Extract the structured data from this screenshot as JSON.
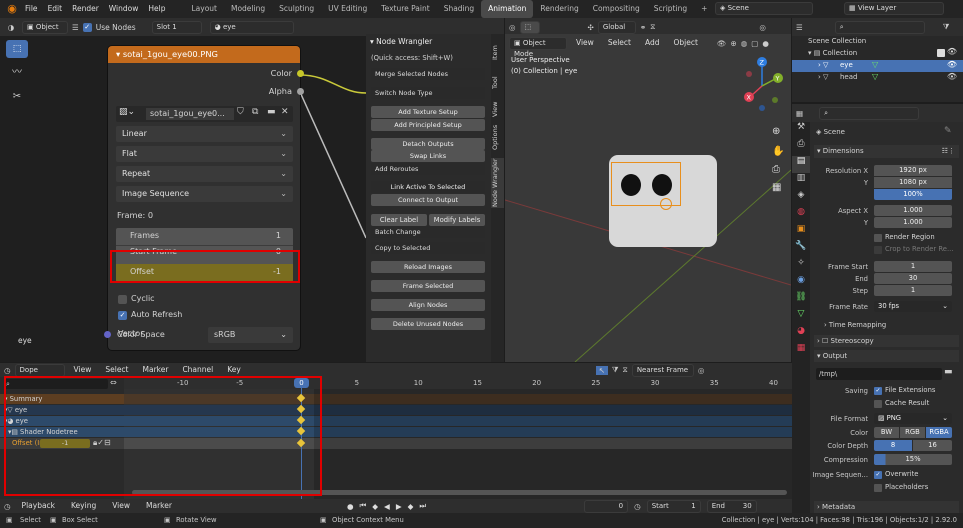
{
  "topbar": {
    "menus": [
      "File",
      "Edit",
      "Render",
      "Window",
      "Help"
    ],
    "workspaces": [
      "Layout",
      "Modeling",
      "Sculpting",
      "UV Editing",
      "Texture Paint",
      "Shading",
      "Animation",
      "Rendering",
      "Compositing",
      "Scripting"
    ],
    "active_workspace": "Animation",
    "add": "+",
    "scene": "Scene",
    "view_layer": "View Layer"
  },
  "node_editor": {
    "header": {
      "editor_type": "Object",
      "use_nodes": "Use Nodes",
      "slot": "Slot 1",
      "material": "eye"
    },
    "node": {
      "title": "sotai_1gou_eye00.PNG",
      "out_color": "Color",
      "out_alpha": "Alpha",
      "image_name": "sotai_1gou_eye0...",
      "interpolation": "Linear",
      "projection": "Flat",
      "extension": "Repeat",
      "source": "Image Sequence",
      "frame_label": "Frame: 0",
      "frames_label": "Frames",
      "frames_value": "1",
      "start_frame_label": "Start Frame",
      "start_frame_value": "0",
      "offset_label": "Offset",
      "offset_value": "-1",
      "cyclic": "Cyclic",
      "auto_refresh": "Auto Refresh",
      "color_space_label": "Color Space",
      "color_space_value": "sRGB",
      "in_vector": "Vector"
    },
    "material_label": "eye"
  },
  "node_wrangler": {
    "title": "Node Wrangler",
    "quick_access": "(Quick access: Shift+W)",
    "merge": "Merge Selected Nodes",
    "switch_type": "Switch Node Type",
    "add_texture": "Add Texture Setup",
    "add_principled": "Add Principled Setup",
    "detach": "Detach Outputs",
    "swap": "Swap Links",
    "add_reroutes": "Add Reroutes",
    "link_active": "Link Active To Selected",
    "connect_output": "Connect to Output",
    "clear_label": "Clear Label",
    "modify_labels": "Modify Labels",
    "batch_change": "Batch Change",
    "copy_selected": "Copy to Selected",
    "reload_images": "Reload Images",
    "frame_selected": "Frame Selected",
    "align_nodes": "Align Nodes",
    "delete_unused": "Delete Unused Nodes",
    "tabs": [
      "Item",
      "Tool",
      "View",
      "Options",
      "Node Wrangler"
    ]
  },
  "viewport": {
    "header": {
      "mode": "Object Mode",
      "menus": [
        "View",
        "Select",
        "Add",
        "Object"
      ],
      "orientation": "Global"
    },
    "perspective": "User Perspective",
    "collection": "(0) Collection | eye",
    "axes": {
      "x": "X",
      "y": "Y",
      "z": "Z"
    }
  },
  "outliner": {
    "scene_collection": "Scene Collection",
    "collection": "Collection",
    "items": [
      "eye",
      "head"
    ]
  },
  "properties": {
    "scene_name": "Scene",
    "dimensions": "Dimensions",
    "res_x_label": "Resolution X",
    "res_x": "1920 px",
    "res_y_label": "Y",
    "res_y": "1080 px",
    "res_pct": "100%",
    "aspect_x_label": "Aspect X",
    "aspect_x": "1.000",
    "aspect_y_label": "Y",
    "aspect_y": "1.000",
    "render_region": "Render Region",
    "crop": "Crop to Render Re...",
    "frame_start_label": "Frame Start",
    "frame_start": "1",
    "end_label": "End",
    "end": "30",
    "step_label": "Step",
    "step": "1",
    "frame_rate_label": "Frame Rate",
    "frame_rate": "30 fps",
    "time_remapping": "Time Remapping",
    "stereoscopy": "Stereoscopy",
    "output": "Output",
    "output_path": "/tmp\\",
    "saving_label": "Saving",
    "file_ext": "File Extensions",
    "cache_result": "Cache Result",
    "file_format_label": "File Format",
    "file_format": "PNG",
    "color_label": "Color",
    "color_bw": "BW",
    "color_rgb": "RGB",
    "color_rgba": "RGBA",
    "depth_label": "Color Depth",
    "depth_8": "8",
    "depth_16": "16",
    "compression_label": "Compression",
    "compression": "15%",
    "image_seq_label": "Image Sequen...",
    "overwrite": "Overwrite",
    "placeholders": "Placeholders",
    "metadata": "Metadata"
  },
  "dopesheet": {
    "header": {
      "mode": "Dope Sheet",
      "menus": [
        "View",
        "Select",
        "Marker",
        "Channel",
        "Key"
      ],
      "snap": "Nearest Frame"
    },
    "current_frame": "0",
    "ticks": [
      "-10",
      "-5",
      "0",
      "5",
      "10",
      "15",
      "20",
      "25",
      "30",
      "35",
      "40"
    ],
    "channels": [
      "Summary",
      "eye",
      "eye",
      "Shader Nodetree",
      "Offset (Im"
    ],
    "offset_value": "-1"
  },
  "playback": {
    "playback": "Playback",
    "keying": "Keying",
    "view": "View",
    "marker": "Marker",
    "frame": "0",
    "start_label": "Start",
    "start": "1",
    "end_label": "End",
    "end": "30"
  },
  "statusbar": {
    "select": "Select",
    "box_select": "Box Select",
    "rotate_view": "Rotate View",
    "context_menu": "Object Context Menu",
    "stats": "Collection | eye | Verts:104 | Faces:98 | Tris:196 | Objects:1/2 | 2.92.0"
  },
  "colors": {
    "accent": "#4772b3",
    "highlight": "#e00000",
    "offset_row": "#7a6d1f",
    "node_header": "#c36a1c"
  }
}
